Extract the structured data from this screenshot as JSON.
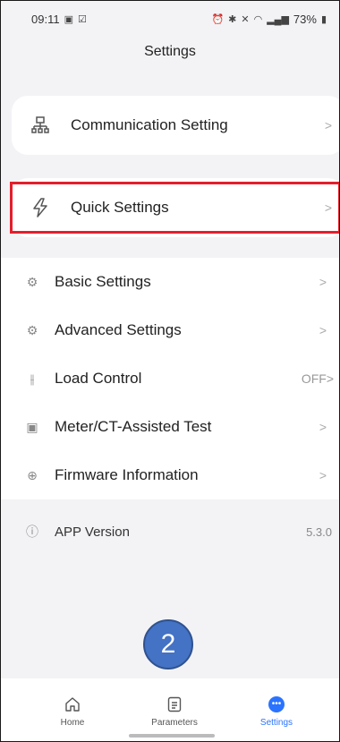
{
  "status": {
    "time": "09:11",
    "right_text": "73%"
  },
  "page_title": "Settings",
  "cards": [
    {
      "label": "Communication Setting",
      "icon": "network-icon",
      "chevron": ">"
    },
    {
      "label": "Quick Settings",
      "icon": "lightning-icon",
      "chevron": ">"
    }
  ],
  "menu_items": [
    {
      "label": "Basic Settings",
      "icon": "gear-icon",
      "chevron": ">"
    },
    {
      "label": "Advanced Settings",
      "icon": "advanced-gear-icon",
      "chevron": ">"
    },
    {
      "label": "Load Control",
      "icon": "sliders-icon",
      "value": "OFF>"
    },
    {
      "label": "Meter/CT-Assisted Test",
      "icon": "meter-test-icon",
      "chevron": ">"
    },
    {
      "label": "Firmware Information",
      "icon": "upload-icon",
      "chevron": ">"
    }
  ],
  "app_version": {
    "label": "APP Version",
    "value": "5.3.0",
    "icon": "info-icon"
  },
  "step_badge": "2",
  "highlight_color": "#e41e2b",
  "tabs": [
    {
      "label": "Home",
      "icon": "home-icon"
    },
    {
      "label": "Parameters",
      "icon": "document-icon"
    },
    {
      "label": "Settings",
      "icon": "more-dots-icon"
    }
  ],
  "accent_color": "#2a73ff"
}
